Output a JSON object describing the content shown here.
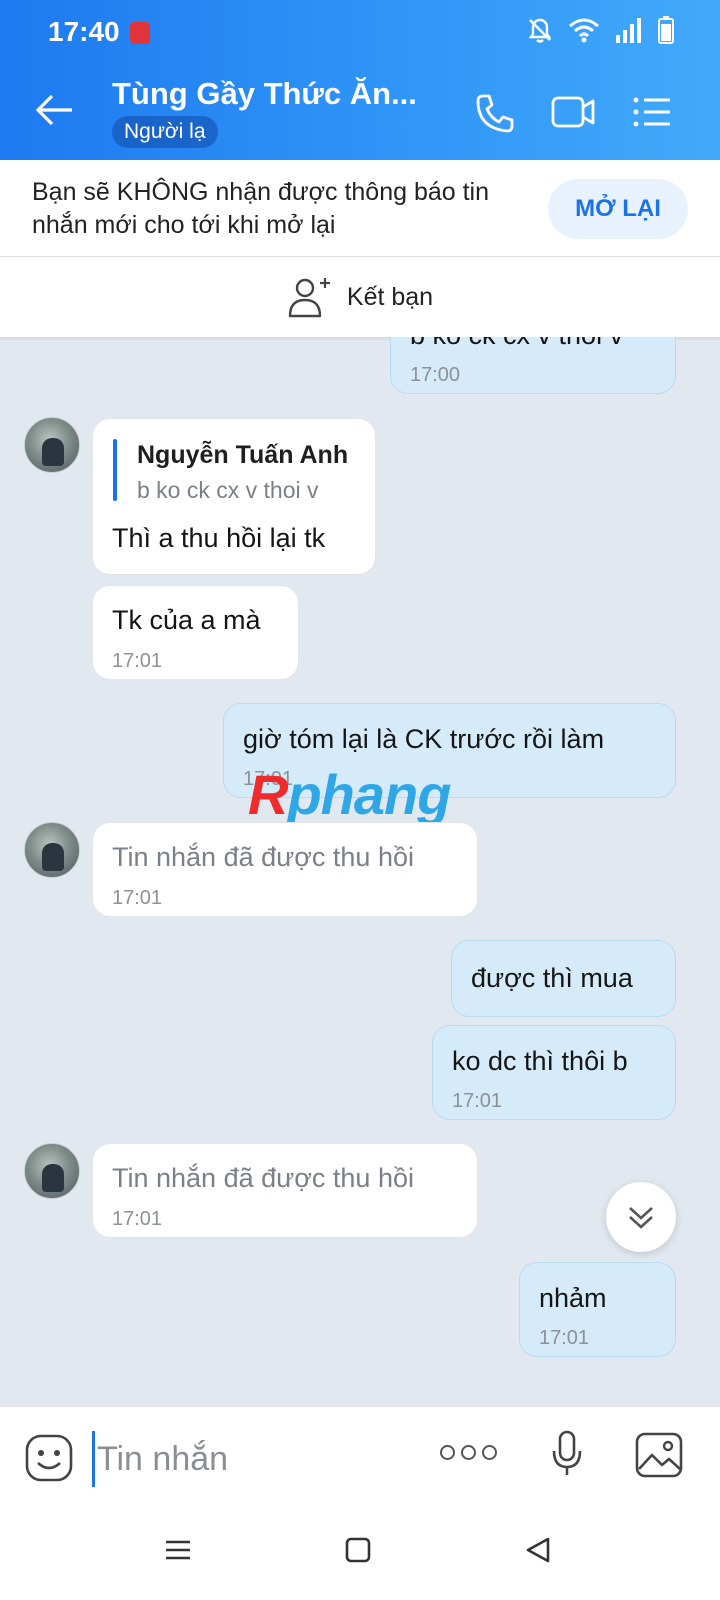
{
  "status_bar": {
    "time": "17:40"
  },
  "header": {
    "title": "Tùng Gầy Thức Ăn...",
    "subtitle_badge": "Người lạ",
    "icons": [
      "back-arrow-icon",
      "phone-icon",
      "video-icon",
      "menu-list-icon"
    ]
  },
  "notice": {
    "text": "Bạn sẽ KHÔNG nhận được thông báo tin nhắn mới cho tới khi mở lại",
    "button_label": "MỞ LẠI"
  },
  "add_friend": {
    "label": "Kết bạn"
  },
  "messages": [
    {
      "direction": "out",
      "text": "b ko ck cx v thoi v",
      "time": "17:00"
    },
    {
      "direction": "in",
      "quote_name": "Nguyễn Tuấn Anh",
      "quote_text": "b ko ck cx v thoi v",
      "text": "Thì a thu hồi lại tk"
    },
    {
      "direction": "in",
      "text": "Tk của a mà",
      "time": "17:01"
    },
    {
      "direction": "out",
      "text": "giờ tóm lại là CK trước rồi làm",
      "time": "17:01"
    },
    {
      "direction": "in",
      "text": "Tin nhắn đã được thu hồi",
      "time": "17:01",
      "recalled": true
    },
    {
      "direction": "out",
      "text": "được thì mua"
    },
    {
      "direction": "out",
      "text": "ko dc thì thôi b",
      "time": "17:01"
    },
    {
      "direction": "in",
      "text": "Tin nhắn đã được thu hồi",
      "time": "17:01",
      "recalled": true
    },
    {
      "direction": "out",
      "text": "nhảm",
      "time": "17:01"
    }
  ],
  "watermark": {
    "part1": "R",
    "part2": "phang"
  },
  "composer": {
    "placeholder": "Tin nhắn"
  },
  "colors": {
    "header_start": "#1e7af0",
    "header_end": "#42aafa",
    "accent": "#1b73e8",
    "outgoing_bubble": "#d5ebfa",
    "chat_bg": "#e2e8f0"
  }
}
